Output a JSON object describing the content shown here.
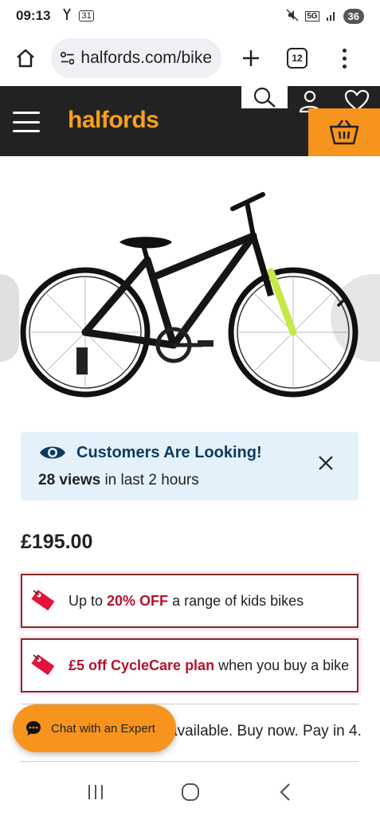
{
  "status_bar": {
    "time": "09:13",
    "calendar_badge": "31",
    "network": "5G",
    "battery": "36"
  },
  "browser": {
    "url": "halfords.com/bike",
    "tab_count": "12"
  },
  "header": {
    "logo": "halfords"
  },
  "gallery": {
    "image_subject": "black kids mountain bike with lime green forks"
  },
  "banner": {
    "title": "Customers Are Looking!",
    "views_count": "28 views",
    "views_suffix": " in last 2 hours"
  },
  "product": {
    "price": "£195.00"
  },
  "promos": [
    {
      "prefix": "Up to ",
      "highlight": "20% OFF",
      "suffix": " a range of kids bikes"
    },
    {
      "prefix": "",
      "highlight": "£5 off CycleCare plan",
      "suffix": " when you buy a bike"
    }
  ],
  "payment": {
    "text": "available. Buy now. Pay in 4."
  },
  "chat": {
    "label": "Chat with an Expert"
  },
  "colors": {
    "brand_orange": "#f7941d",
    "header_dark": "#222222",
    "promo_red": "#b3122e",
    "banner_blue": "#e3f1fb"
  }
}
